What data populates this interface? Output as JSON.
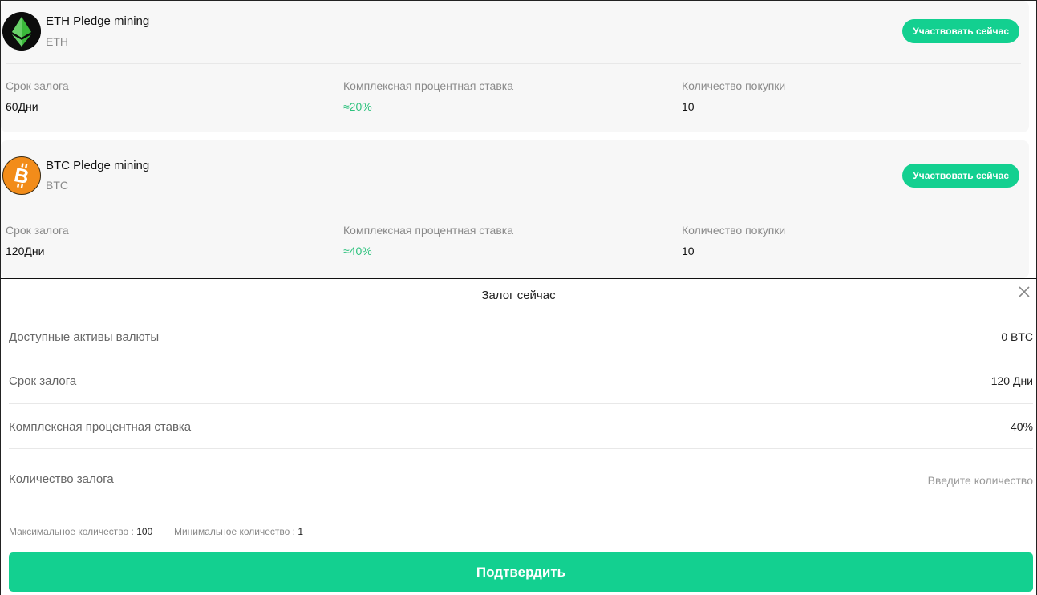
{
  "products": [
    {
      "name": "ETH Pledge mining",
      "symbol": "ETH",
      "icon": "eth-coin-icon",
      "join_label": "Участвовать сейчас",
      "term_label": "Срок залога",
      "term_value": "60Дни",
      "rate_label": "Комплексная процентная ставка",
      "rate_value": "≈20%",
      "qty_label": "Количество покупки",
      "qty_value": "10"
    },
    {
      "name": "BTC Pledge mining",
      "symbol": "BTC",
      "icon": "btc-coin-icon",
      "join_label": "Участвовать сейчас",
      "term_label": "Срок залога",
      "term_value": "120Дни",
      "rate_label": "Комплексная процентная ставка",
      "rate_value": "≈40%",
      "qty_label": "Количество покупки",
      "qty_value": "10"
    }
  ],
  "modal": {
    "title": "Залог сейчас",
    "close_icon": "close-icon",
    "rows": [
      {
        "label": "Доступные активы валюты",
        "value": "0 BTC"
      },
      {
        "label": "Срок залога",
        "value": "120 Дни"
      },
      {
        "label": "Комплексная процентная ставка",
        "value": "40%"
      }
    ],
    "amount": {
      "label": "Количество залога",
      "placeholder": "Введите количество",
      "value": ""
    },
    "limits": {
      "max_label": "Максимальное количество :",
      "max_value": "100",
      "min_label": "Минимальное количество :",
      "min_value": "1"
    },
    "confirm_label": "Подтвердить"
  },
  "colors": {
    "accent": "#13d090",
    "rate_green": "#2ec27e",
    "card_bg": "#f7f7f7",
    "muted_text": "#8a8a8a"
  }
}
